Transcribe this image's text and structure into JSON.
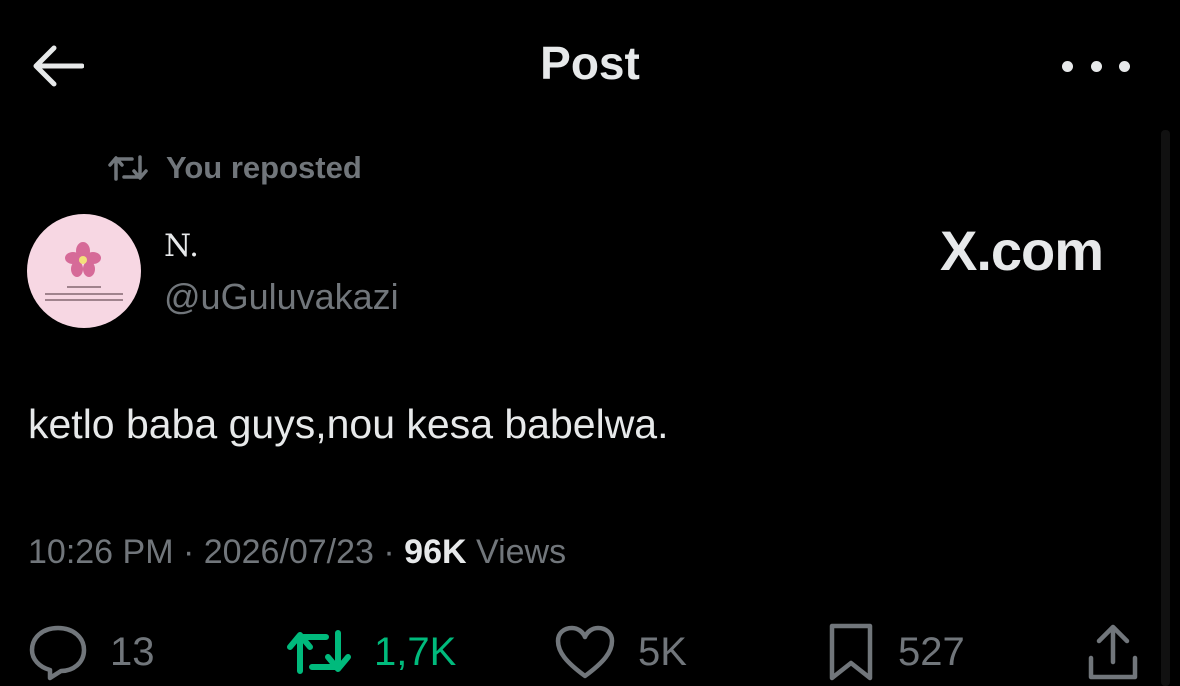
{
  "header": {
    "back_icon": "arrow-left-icon",
    "title": "Post",
    "more_icon": "more-dots-icon"
  },
  "repost_notice": {
    "icon": "repost-icon",
    "label": "You reposted"
  },
  "author": {
    "name": "N.",
    "handle": "@uGuluvakazi",
    "avatar_color": "#f7d7e3"
  },
  "brand": {
    "label": "X.com"
  },
  "post": {
    "text": "ketlo baba guys,nou kesa babelwa.",
    "time": "10:26 PM",
    "date": "2026/07/23",
    "separator": "·",
    "views_count": "96K",
    "views_label": "Views"
  },
  "actions": {
    "reply": {
      "icon": "reply-icon",
      "count": "13"
    },
    "repost": {
      "icon": "repost-icon",
      "count": "1,7K",
      "active": true,
      "color": "#00ba7c"
    },
    "like": {
      "icon": "heart-icon",
      "count": "5K"
    },
    "bookmark": {
      "icon": "bookmark-icon",
      "count": "527"
    },
    "share": {
      "icon": "share-icon"
    }
  },
  "colors": {
    "background": "#000000",
    "primary_text": "#e7e9ea",
    "secondary_text": "#71767b",
    "repost_active": "#00ba7c"
  }
}
